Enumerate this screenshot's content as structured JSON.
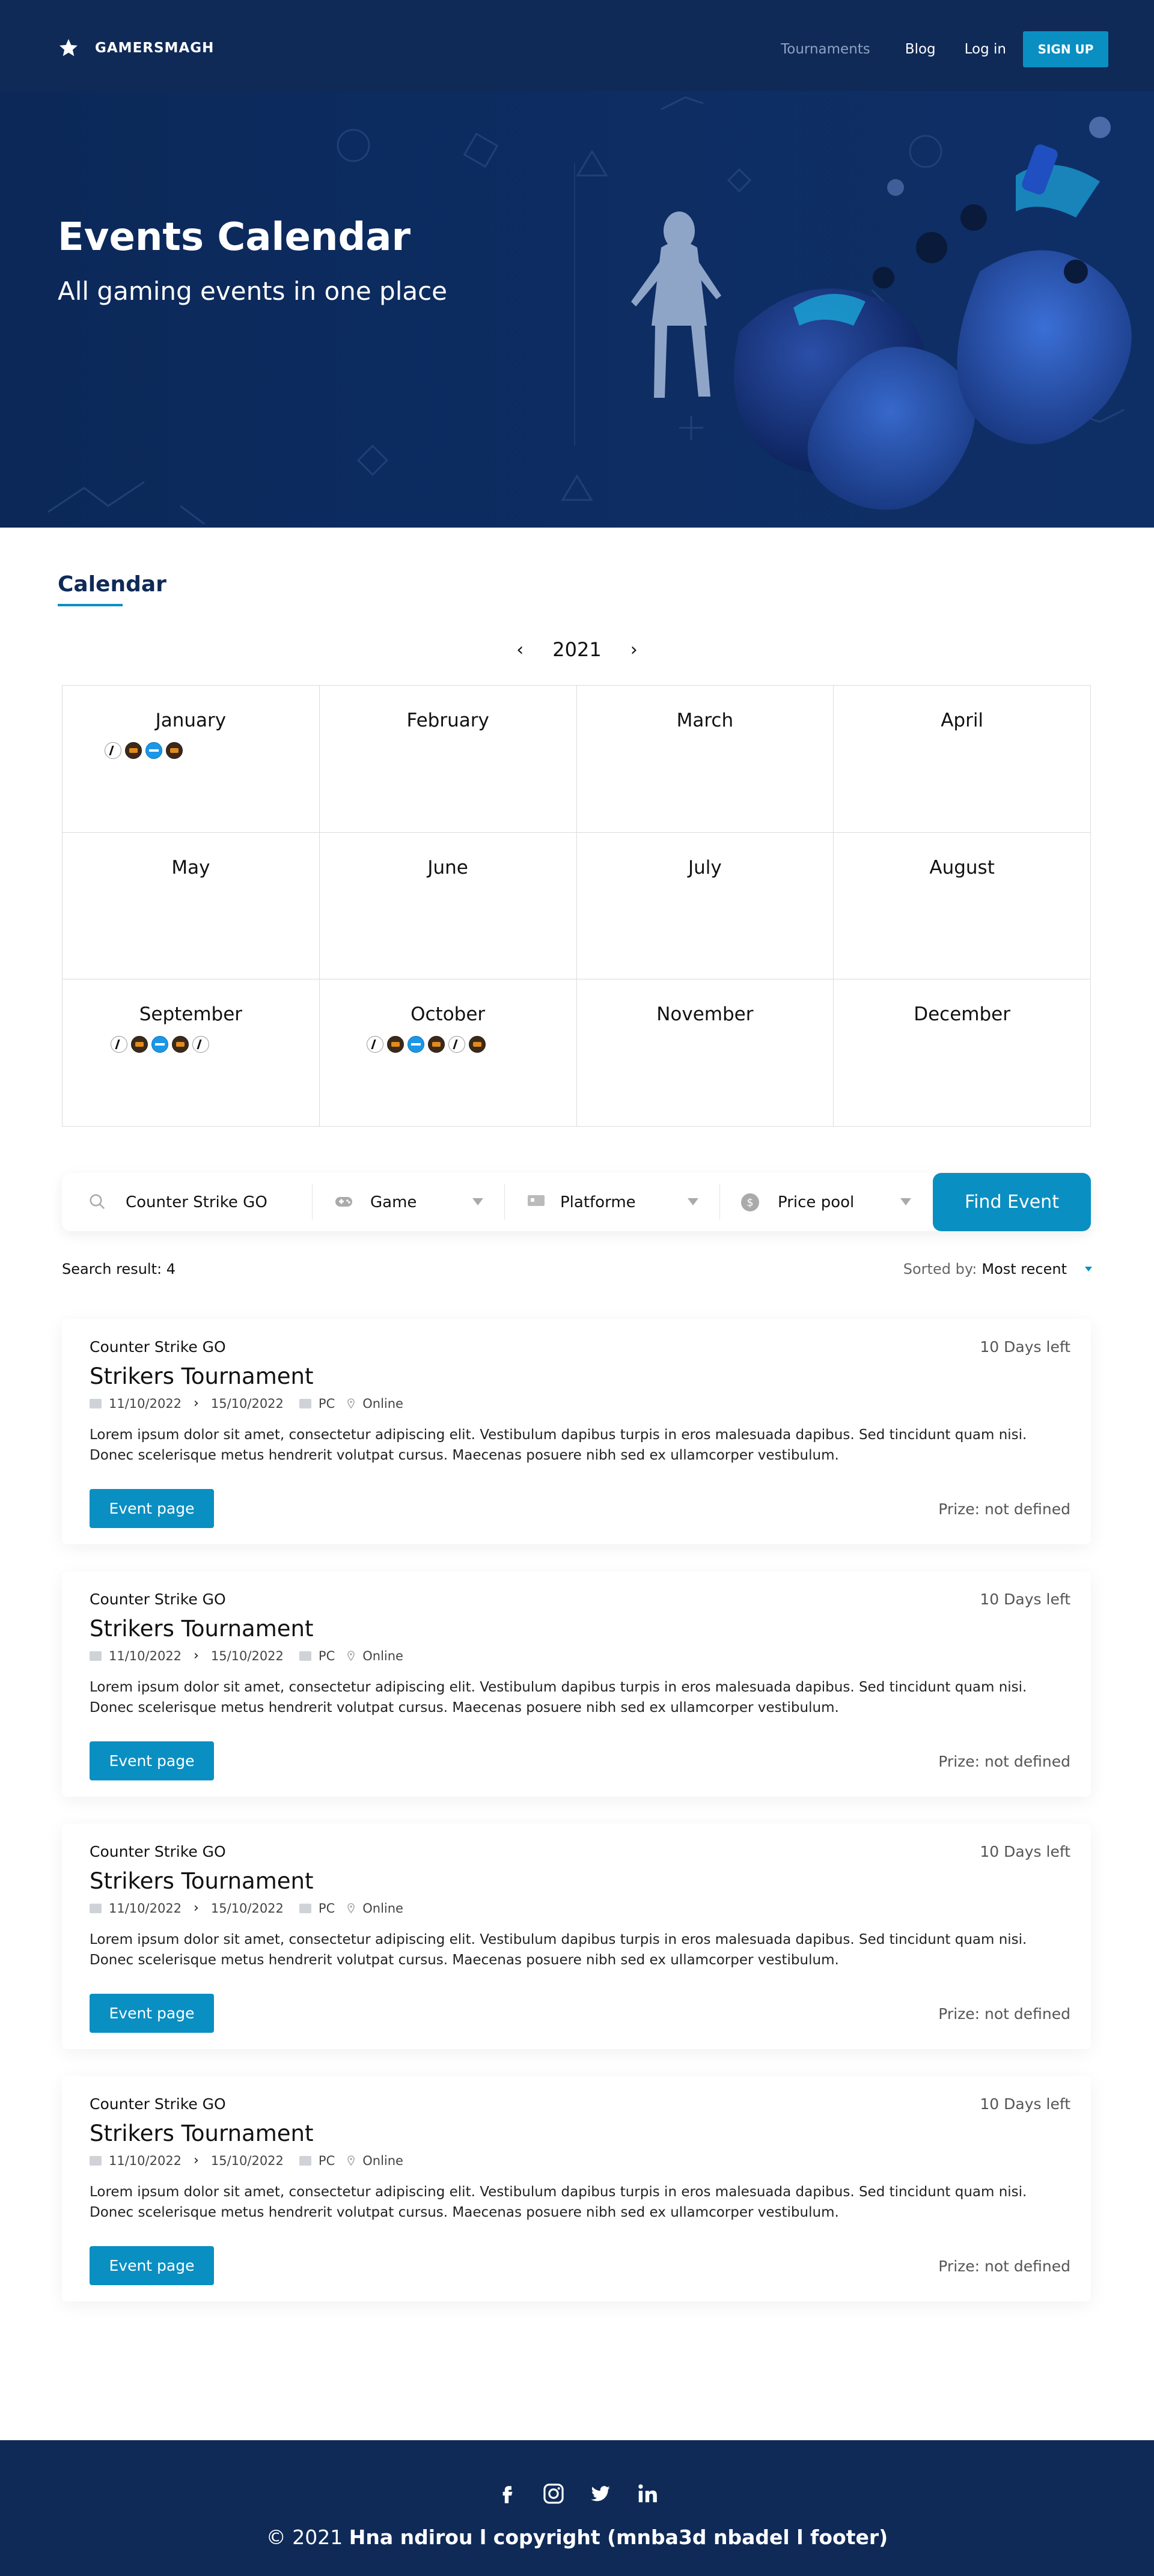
{
  "nav": {
    "brand": "GAMERSMAGH",
    "links": [
      "Tournaments",
      "Blog",
      "Log in"
    ],
    "signup": "SIGN UP"
  },
  "hero": {
    "title": "Events Calendar",
    "subtitle": "All gaming events in one place"
  },
  "calendar": {
    "heading": "Calendar",
    "year": "2021",
    "months": [
      "January",
      "February",
      "March",
      "April",
      "May",
      "June",
      "July",
      "August",
      "September",
      "October",
      "November",
      "December"
    ],
    "events_by_month": {
      "January": [
        "cs-icon",
        "brawl-icon",
        "blue-icon",
        "brawl-icon"
      ],
      "September": [
        "cs-icon",
        "brawl-icon",
        "blue-icon",
        "brawl-icon",
        "cs-icon"
      ],
      "October": [
        "cs-icon",
        "brawl-icon",
        "blue-icon",
        "brawl-icon",
        "cs-icon",
        "brawl-icon"
      ]
    }
  },
  "search": {
    "query": "Counter Strike GO",
    "game": "Game",
    "platform": "Platforme",
    "price": "Price pool",
    "button": "Find Event"
  },
  "results": {
    "count_label": "Search result: 4",
    "sorted_label": "Sorted by:",
    "sorted_value": "Most recent"
  },
  "events": [
    {
      "game": "Counter Strike GO",
      "days_left": "10 Days left",
      "title": "Strikers Tournament",
      "start": "11/10/2022",
      "end": "15/10/2022",
      "platform": "PC",
      "location": "Online",
      "desc1": "Lorem ipsum dolor sit amet, consectetur adipiscing elit. Vestibulum dapibus turpis in eros malesuada dapibus. Sed tincidunt quam nisi.",
      "desc2": "Donec scelerisque metus hendrerit volutpat cursus. Maecenas posuere nibh sed ex ullamcorper vestibulum.",
      "button": "Event page",
      "prize": "Prize: not defined"
    },
    {
      "game": "Counter Strike GO",
      "days_left": "10 Days left",
      "title": "Strikers Tournament",
      "start": "11/10/2022",
      "end": "15/10/2022",
      "platform": "PC",
      "location": "Online",
      "desc1": "Lorem ipsum dolor sit amet, consectetur adipiscing elit. Vestibulum dapibus turpis in eros malesuada dapibus. Sed tincidunt quam nisi.",
      "desc2": "Donec scelerisque metus hendrerit volutpat cursus. Maecenas posuere nibh sed ex ullamcorper vestibulum.",
      "button": "Event page",
      "prize": "Prize: not defined"
    },
    {
      "game": "Counter Strike GO",
      "days_left": "10 Days left",
      "title": "Strikers Tournament",
      "start": "11/10/2022",
      "end": "15/10/2022",
      "platform": "PC",
      "location": "Online",
      "desc1": "Lorem ipsum dolor sit amet, consectetur adipiscing elit. Vestibulum dapibus turpis in eros malesuada dapibus. Sed tincidunt quam nisi.",
      "desc2": "Donec scelerisque metus hendrerit volutpat cursus. Maecenas posuere nibh sed ex ullamcorper vestibulum.",
      "button": "Event page",
      "prize": "Prize: not defined"
    },
    {
      "game": "Counter Strike GO",
      "days_left": "10 Days left",
      "title": "Strikers Tournament",
      "start": "11/10/2022",
      "end": "15/10/2022",
      "platform": "PC",
      "location": "Online",
      "desc1": "Lorem ipsum dolor sit amet, consectetur adipiscing elit. Vestibulum dapibus turpis in eros malesuada dapibus. Sed tincidunt quam nisi.",
      "desc2": "Donec scelerisque metus hendrerit volutpat cursus. Maecenas posuere nibh sed ex ullamcorper vestibulum.",
      "button": "Event page",
      "prize": "Prize: not defined"
    }
  ],
  "footer": {
    "socials": [
      "facebook-icon",
      "instagram-icon",
      "twitter-icon",
      "linkedin-icon"
    ],
    "copyright_prefix": "© 2021 ",
    "copyright_bold": "Hna ndirou l copyright (mnba3d nbadel l footer)"
  },
  "colors": {
    "navy": "#0f2a57",
    "accent": "#0a8fc2"
  }
}
